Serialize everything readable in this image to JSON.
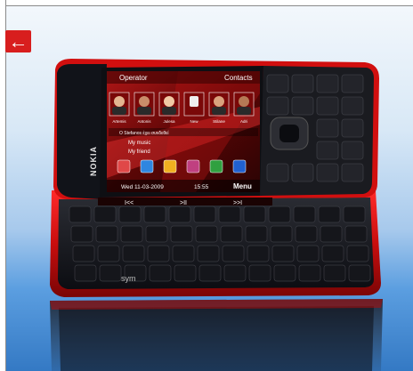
{
  "nav": {
    "back_icon": "left-arrow-icon",
    "back_glyph": "←",
    "accent": "#d81e1e"
  },
  "phone": {
    "brand": "NOKIA",
    "screen": {
      "operator_label": "Operator",
      "contacts_label": "Contacts",
      "contacts": [
        {
          "name": "Artemis"
        },
        {
          "name": "Antonis"
        },
        {
          "name": "Julesa"
        },
        {
          "name": "New"
        },
        {
          "name": "Stilane"
        },
        {
          "name": "Adri"
        }
      ],
      "status_line": "Ο Stefanos έχει συνδεθεί",
      "music_label": "My music",
      "music_label_2": "My friend",
      "date": "Wed 11-03-2009",
      "time": "15:55",
      "menu_label": "Menu"
    },
    "media_keys": [
      "I<<",
      ">II",
      ">>I"
    ],
    "keyboard_label": "sym"
  }
}
